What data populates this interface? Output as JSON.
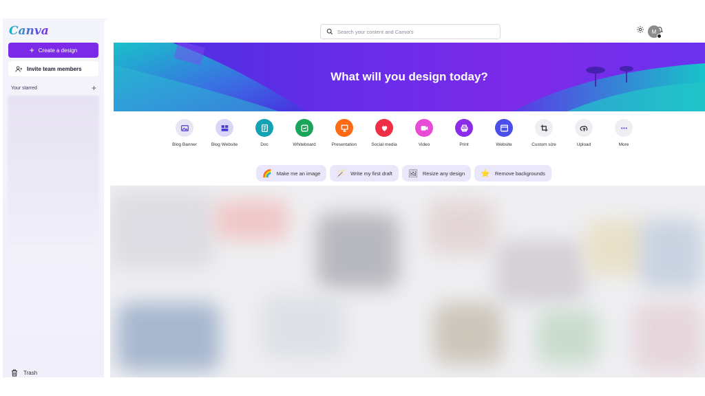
{
  "app": {
    "logo": "Canva",
    "create_label": "Create a design",
    "invite_label": "Invite team members",
    "starred_label": "Your starred",
    "trash_label": "Trash"
  },
  "search": {
    "placeholder": "Search your content and Canva's"
  },
  "avatar": {
    "initial": "M"
  },
  "hero": {
    "title": "What will you design today?"
  },
  "design_types": [
    {
      "label": "Blog Banner",
      "icon": "image-icon",
      "color": "#e8e6f5",
      "fg": "#5b4bd6"
    },
    {
      "label": "Blog Website",
      "icon": "website-grid-icon",
      "color": "#d9d6f7",
      "fg": "#4a3fd0"
    },
    {
      "label": "Doc",
      "icon": "doc-icon",
      "color": "#13a3b5",
      "fg": "#ffffff"
    },
    {
      "label": "Whiteboard",
      "icon": "whiteboard-icon",
      "color": "#1aa55a",
      "fg": "#ffffff"
    },
    {
      "label": "Presentation",
      "icon": "presentation-icon",
      "color": "#ff6a14",
      "fg": "#ffffff"
    },
    {
      "label": "Social media",
      "icon": "heart-icon",
      "color": "#ef2f45",
      "fg": "#ffffff"
    },
    {
      "label": "Video",
      "icon": "video-icon",
      "color": "#e84bd6",
      "fg": "#ffffff"
    },
    {
      "label": "Print",
      "icon": "print-icon",
      "color": "#8a2ce8",
      "fg": "#ffffff"
    },
    {
      "label": "Website",
      "icon": "website-icon",
      "color": "#4b4ee8",
      "fg": "#ffffff"
    },
    {
      "label": "Custom size",
      "icon": "crop-icon",
      "color": "#efeff3",
      "fg": "#333333"
    },
    {
      "label": "Upload",
      "icon": "cloud-upload-icon",
      "color": "#efeff3",
      "fg": "#333333"
    },
    {
      "label": "More",
      "icon": "more-icon",
      "color": "#efeff3",
      "fg": "#5b4bd6"
    }
  ],
  "chips": [
    {
      "label": "Make me an image",
      "icon": "🌈"
    },
    {
      "label": "Write my first draft",
      "icon": "🪄"
    },
    {
      "label": "Resize any design",
      "icon": "🖼"
    },
    {
      "label": "Remove backgrounds",
      "icon": "⭐"
    }
  ],
  "colors": {
    "accent": "#7d2ae8",
    "hero_start": "#4a2fe0",
    "hero_end": "#7d2ae8"
  }
}
